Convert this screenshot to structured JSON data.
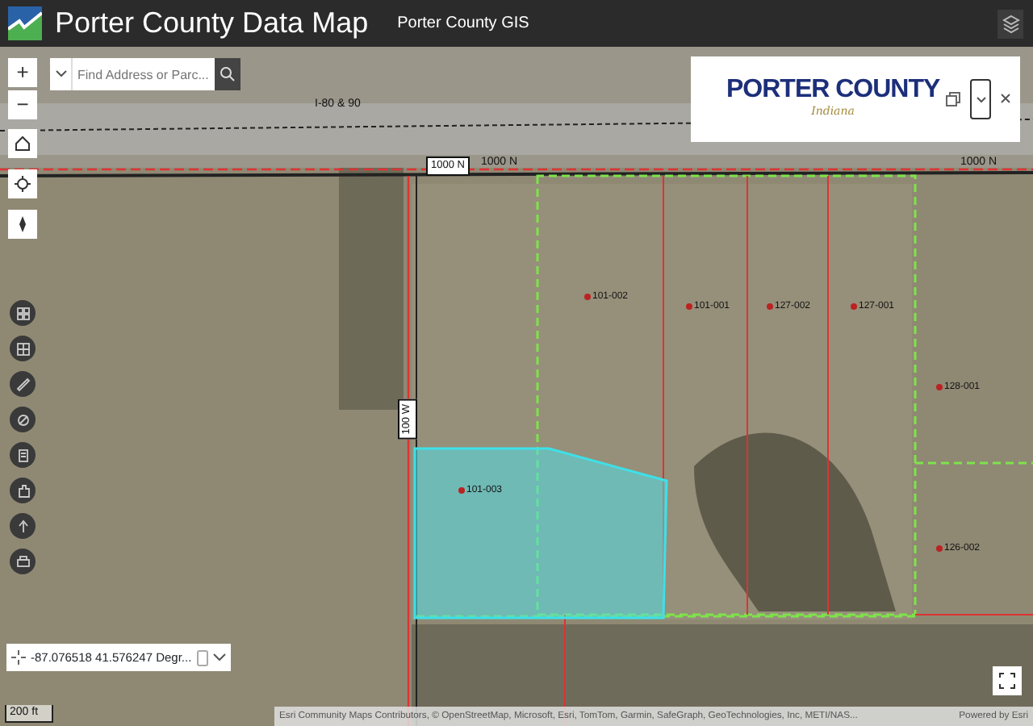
{
  "header": {
    "title": "Porter County Data Map",
    "subtitle": "Porter County GIS"
  },
  "zoom": [
    "+",
    "−"
  ],
  "search": {
    "placeholder": "Find Address or Parc..."
  },
  "logo": {
    "name": "PORTER COUNTY",
    "tagline": "Indiana"
  },
  "map_labels": [
    {
      "kind": "road",
      "text": "I-80 & 90"
    },
    {
      "kind": "road-box",
      "text": "1000 N"
    },
    {
      "kind": "road",
      "text": "1000 N"
    },
    {
      "kind": "road",
      "text": "1000 N"
    },
    {
      "kind": "road-box",
      "text": "100 W"
    },
    {
      "kind": "parcel",
      "text": "101-002"
    },
    {
      "kind": "parcel",
      "text": "101-001"
    },
    {
      "kind": "parcel",
      "text": "127-002"
    },
    {
      "kind": "parcel",
      "text": "127-001"
    },
    {
      "kind": "parcel",
      "text": "101-003"
    },
    {
      "kind": "parcel",
      "text": "128-001"
    },
    {
      "kind": "parcel",
      "text": "126-002"
    }
  ],
  "coordinates": {
    "value": "-87.076518 41.576247 Degr..."
  },
  "scale": "200 ft",
  "attribution": {
    "text": "Esri Community Maps Contributors, © OpenStreetMap, Microsoft, Esri, TomTom, Garmin, SafeGraph, GeoTechnologies, Inc, METI/NAS...",
    "powered": "Powered by Esri"
  }
}
